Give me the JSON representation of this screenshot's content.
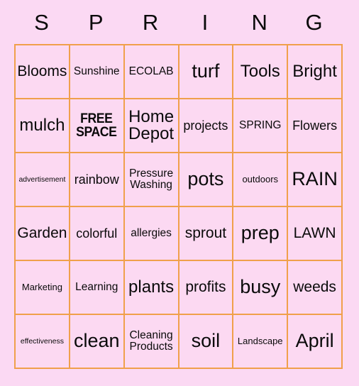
{
  "card": {
    "title_letters": [
      "S",
      "P",
      "R",
      "I",
      "N",
      "G"
    ],
    "border_color": "#f0a04b",
    "page_background": "#fbd9f3",
    "cell_background": "#fcd9f2",
    "text_color": "#0a0a0a",
    "columns": 6,
    "rows": 6,
    "free_space": {
      "line1": "FREE",
      "line2": "SPACE"
    },
    "cells": [
      [
        {
          "text": "Blooms",
          "size": "fs-l"
        },
        {
          "text": "Sunshine",
          "size": "fs-s"
        },
        {
          "text": "ECOLAB",
          "size": "fs-s"
        },
        {
          "text": "turf",
          "size": "fs-xxl"
        },
        {
          "text": "Tools",
          "size": "fs-xl"
        },
        {
          "text": "Bright",
          "size": "fs-xl"
        }
      ],
      [
        {
          "text": "mulch",
          "size": "fs-xl"
        },
        {
          "text": "FREE SPACE",
          "size": "free"
        },
        {
          "text": "Home Depot",
          "size": "fs-xl"
        },
        {
          "text": "projects",
          "size": "fs-m"
        },
        {
          "text": "SPRING",
          "size": "fs-s"
        },
        {
          "text": "Flowers",
          "size": "fs-m"
        }
      ],
      [
        {
          "text": "advertisement",
          "size": "fs-xxs"
        },
        {
          "text": "rainbow",
          "size": "fs-m"
        },
        {
          "text": "Pressure Washing",
          "size": "fs-s"
        },
        {
          "text": "pots",
          "size": "fs-xxl"
        },
        {
          "text": "outdoors",
          "size": "fs-xs"
        },
        {
          "text": "RAIN",
          "size": "fs-xxl"
        }
      ],
      [
        {
          "text": "Garden",
          "size": "fs-l"
        },
        {
          "text": "colorful",
          "size": "fs-m"
        },
        {
          "text": "allergies",
          "size": "fs-s"
        },
        {
          "text": "sprout",
          "size": "fs-l"
        },
        {
          "text": "prep",
          "size": "fs-xxl"
        },
        {
          "text": "LAWN",
          "size": "fs-l"
        }
      ],
      [
        {
          "text": "Marketing",
          "size": "fs-xs"
        },
        {
          "text": "Learning",
          "size": "fs-s"
        },
        {
          "text": "plants",
          "size": "fs-xl"
        },
        {
          "text": "profits",
          "size": "fs-l"
        },
        {
          "text": "busy",
          "size": "fs-xxl"
        },
        {
          "text": "weeds",
          "size": "fs-l"
        }
      ],
      [
        {
          "text": "effectiveness",
          "size": "fs-xxs"
        },
        {
          "text": "clean",
          "size": "fs-xxl"
        },
        {
          "text": "Cleaning Products",
          "size": "fs-s"
        },
        {
          "text": "soil",
          "size": "fs-xxl"
        },
        {
          "text": "Landscape",
          "size": "fs-xs"
        },
        {
          "text": "April",
          "size": "fs-xxl"
        }
      ]
    ]
  }
}
